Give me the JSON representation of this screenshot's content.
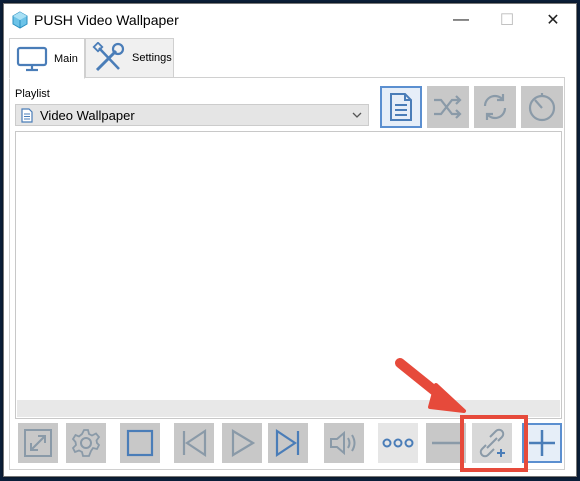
{
  "window": {
    "title": "PUSH Video Wallpaper",
    "controls": {
      "minimize": "—",
      "maximize": "☐",
      "close": "✕"
    }
  },
  "tabs": [
    {
      "label": "Main",
      "icon": "monitor-icon",
      "active": true
    },
    {
      "label": "Settings",
      "icon": "wrench-screwdriver-icon",
      "active": false
    }
  ],
  "playlist": {
    "label": "Playlist",
    "selected": "Video Wallpaper"
  },
  "playlist_buttons": [
    "playlist-document-icon",
    "shuffle-icon",
    "repeat-icon",
    "timer-icon"
  ],
  "bottom_buttons": [
    "fullscreen-icon",
    "gear-icon",
    "stop-icon",
    "previous-icon",
    "play-icon",
    "next-icon",
    "volume-icon",
    "more-icon",
    "remove-icon",
    "add-url-icon",
    "add-icon"
  ],
  "colors": {
    "accent_border": "#5b8fd0",
    "button_gray": "#c8c8c8",
    "icon_gray": "#8a9aa8",
    "icon_blue": "#4a7db8",
    "highlight_red": "#e64a3b"
  }
}
